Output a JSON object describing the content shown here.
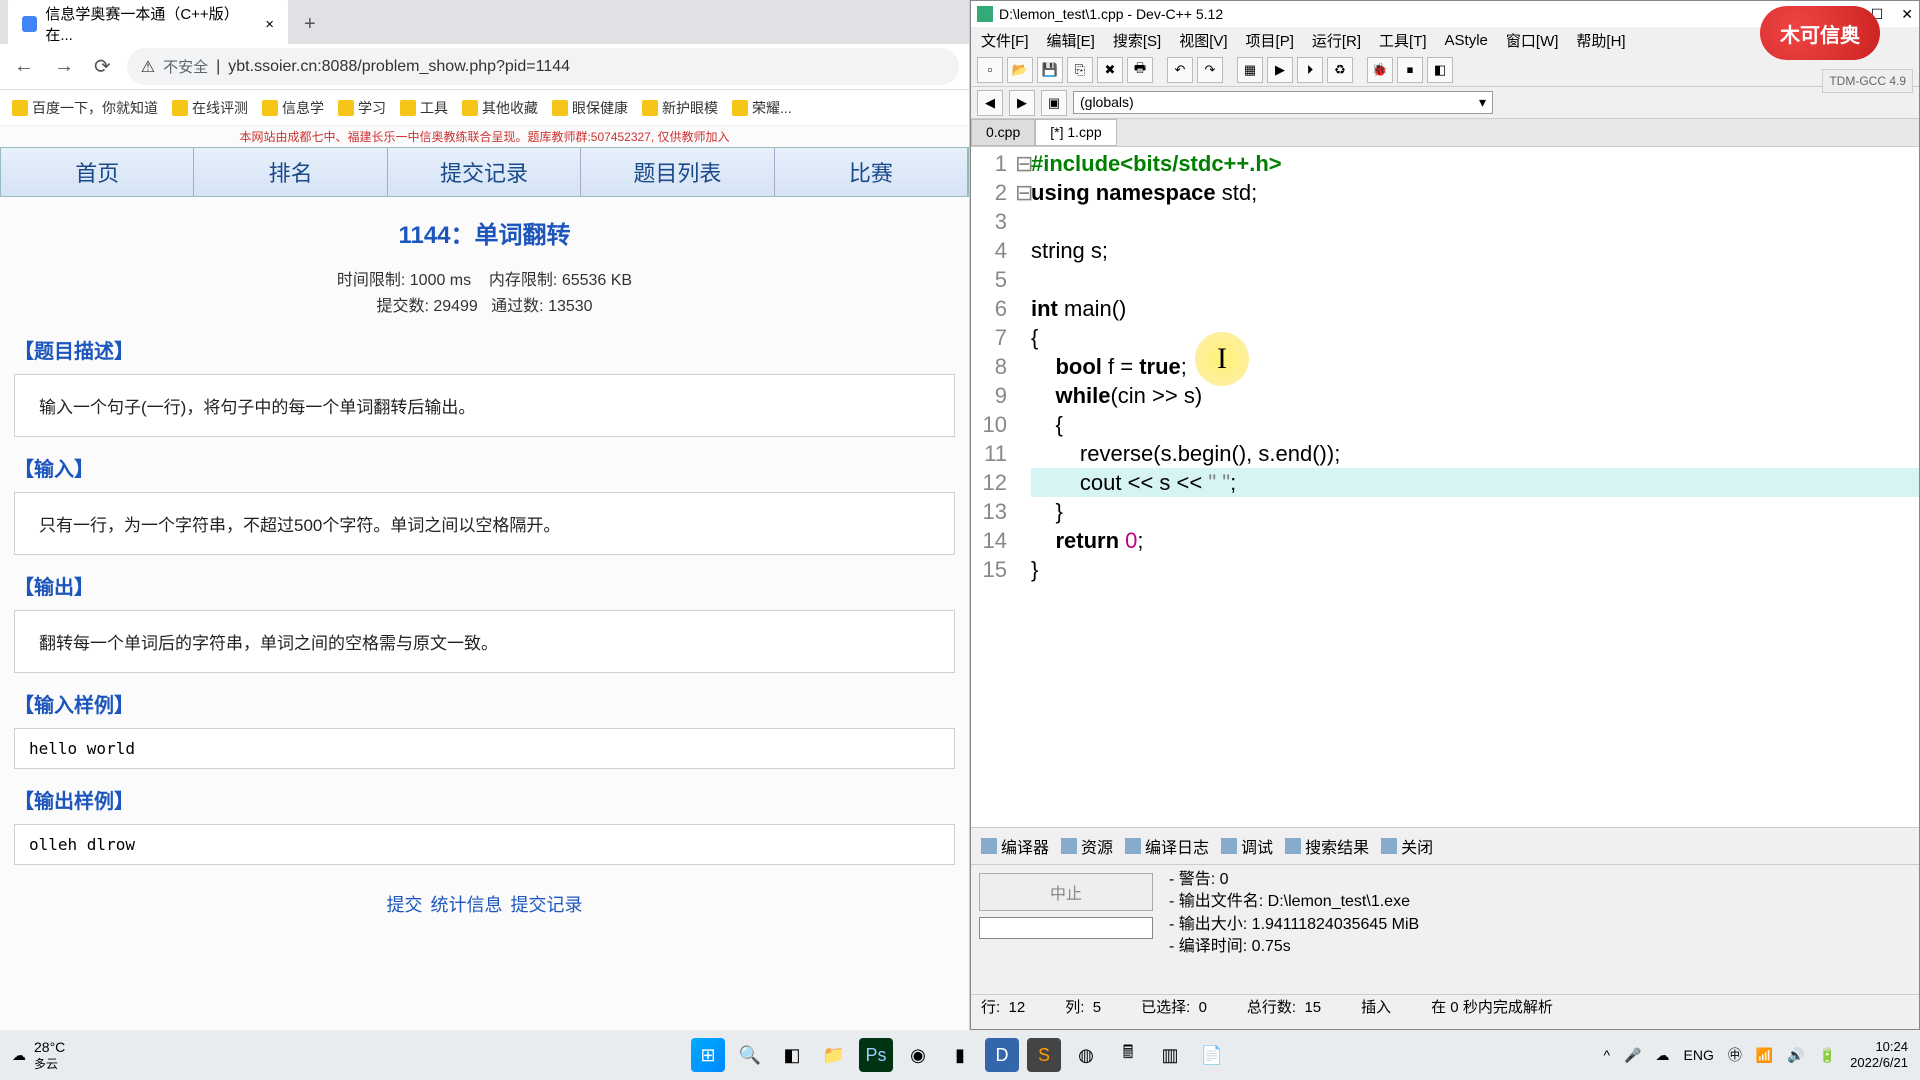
{
  "browser": {
    "tab_title": "信息学奥赛一本通（C++版）在...",
    "url": "ybt.ssoier.cn:8088/problem_show.php?pid=1144",
    "insecure_label": "不安全",
    "bookmarks": [
      "百度一下，你就知道",
      "在线评测",
      "信息学",
      "学习",
      "工具",
      "其他收藏",
      "眼保健康",
      "新护眼模",
      "荣耀..."
    ],
    "banner": "本网站由成都七中、福建长乐一中信奥教练联合呈现。题库教师群:507452327, 仅供教师加入",
    "nav": [
      "首页",
      "排名",
      "提交记录",
      "题目列表",
      "比赛"
    ],
    "problem": {
      "title": "1144：单词翻转",
      "time_limit": "时间限制: 1000 ms",
      "mem_limit": "内存限制: 65536 KB",
      "submit_count": "提交数: 29499",
      "pass_count": "通过数: 13530",
      "sec_desc_h": "【题目描述】",
      "sec_desc": "输入一个句子(一行)，将句子中的每一个单词翻转后输出。",
      "sec_in_h": "【输入】",
      "sec_in": "只有一行，为一个字符串，不超过500个字符。单词之间以空格隔开。",
      "sec_out_h": "【输出】",
      "sec_out": "翻转每一个单词后的字符串，单词之间的空格需与原文一致。",
      "sec_in_ex_h": "【输入样例】",
      "sec_in_ex": "hello world",
      "sec_out_ex_h": "【输出样例】",
      "sec_out_ex": "olleh dlrow",
      "links": [
        "提交",
        "统计信息",
        "提交记录"
      ]
    }
  },
  "devcpp": {
    "title": "D:\\lemon_test\\1.cpp - Dev-C++ 5.12",
    "menus": [
      "文件[F]",
      "编辑[E]",
      "搜索[S]",
      "视图[V]",
      "项目[P]",
      "运行[R]",
      "工具[T]",
      "AStyle",
      "窗口[W]",
      "帮助[H]"
    ],
    "combo": "(globals)",
    "tabs": [
      "0.cpp",
      "[*] 1.cpp"
    ],
    "active_tab": 1,
    "code_lines": [
      {
        "n": 1,
        "html": "<span class='pp'>#include&lt;bits/stdc++.h&gt;</span>"
      },
      {
        "n": 2,
        "html": "<span class='kw'>using</span> <span class='kw'>namespace</span> std;"
      },
      {
        "n": 3,
        "html": ""
      },
      {
        "n": 4,
        "html": "string s;"
      },
      {
        "n": 5,
        "html": ""
      },
      {
        "n": 6,
        "html": "<span class='kw'>int</span> main<span class='fn'>()</span>"
      },
      {
        "n": 7,
        "html": "{",
        "fold": "⊟"
      },
      {
        "n": 8,
        "html": "    <span class='kw'>bool</span> f = <span class='kw'>true</span>;"
      },
      {
        "n": 9,
        "html": "    <span class='kw'>while</span>(cin &gt;&gt; s)"
      },
      {
        "n": 10,
        "html": "    {",
        "fold": "⊟"
      },
      {
        "n": 11,
        "html": "        reverse(s.begin(), s.end());"
      },
      {
        "n": 12,
        "html": "        cout &lt;&lt; s &lt;&lt; <span class='st'>\" \"</span>;"
      },
      {
        "n": 13,
        "html": "    }"
      },
      {
        "n": 14,
        "html": "    <span class='kw'>return</span> <span class='nm'>0</span>;"
      },
      {
        "n": 15,
        "html": "}"
      }
    ],
    "bottom_tabs": [
      "编译器",
      "资源",
      "编译日志",
      "调试",
      "搜索结果",
      "关闭"
    ],
    "stop_btn": "中止",
    "compile_log": [
      "- 警告: 0",
      "- 输出文件名: D:\\lemon_test\\1.exe",
      "- 输出大小: 1.94111824035645 MiB",
      "- 编译时间: 0.75s"
    ],
    "status": {
      "row_label": "行:",
      "row": "12",
      "col_label": "列:",
      "col": "5",
      "sel_label": "已选择:",
      "sel": "0",
      "total_label": "总行数:",
      "total": "15",
      "mode": "插入",
      "parse": "在 0 秒内完成解析"
    },
    "tdm": "TDM-GCC 4.9",
    "logo": "木可信奥"
  },
  "taskbar": {
    "temp": "28°C",
    "weather": "多云",
    "lang": "ENG",
    "time": "10:24",
    "date": "2022/6/21"
  }
}
